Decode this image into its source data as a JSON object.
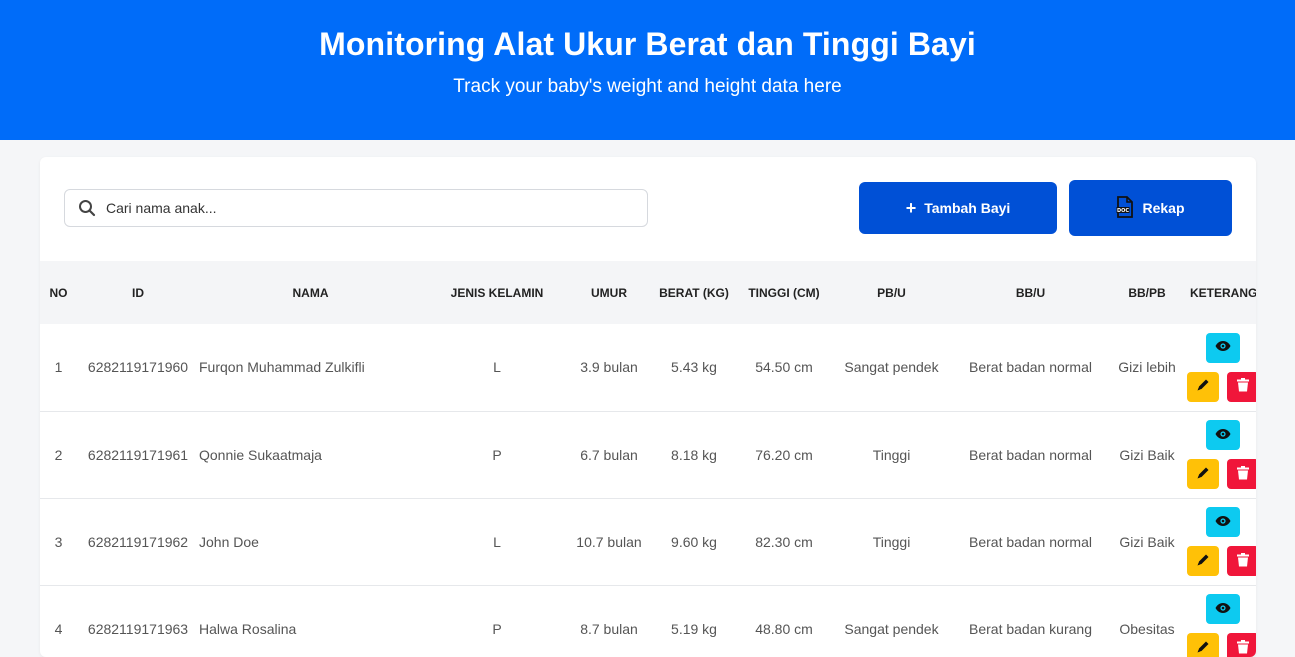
{
  "header": {
    "title": "Monitoring Alat Ukur Berat dan Tinggi Bayi",
    "subtitle": "Track your baby's weight and height data here"
  },
  "toolbar": {
    "search_placeholder": "Cari nama anak...",
    "search_icon": "search-icon",
    "add_label": "Tambah Bayi",
    "add_icon": "plus-icon",
    "rekap_label": "Rekap",
    "rekap_icon": "doc-file-icon"
  },
  "table": {
    "columns": [
      "NO",
      "ID",
      "NAMA",
      "JENIS KELAMIN",
      "UMUR",
      "BERAT (KG)",
      "TINGGI (CM)",
      "PB/U",
      "BB/U",
      "BB/PB",
      "KETERANGAN"
    ],
    "rows": [
      {
        "no": "1",
        "id": "6282119171960",
        "nama": "Furqon Muhammad Zulkifli",
        "jk": "L",
        "umur": "3.9 bulan",
        "berat": "5.43 kg",
        "tinggi": "54.50 cm",
        "pbu": "Sangat pendek",
        "bbu": "Berat badan normal",
        "bbpb": "Gizi lebih"
      },
      {
        "no": "2",
        "id": "6282119171961",
        "nama": "Qonnie Sukaatmaja",
        "jk": "P",
        "umur": "6.7 bulan",
        "berat": "8.18 kg",
        "tinggi": "76.20 cm",
        "pbu": "Tinggi",
        "bbu": "Berat badan normal",
        "bbpb": "Gizi Baik"
      },
      {
        "no": "3",
        "id": "6282119171962",
        "nama": "John Doe",
        "jk": "L",
        "umur": "10.7 bulan",
        "berat": "9.60 kg",
        "tinggi": "82.30 cm",
        "pbu": "Tinggi",
        "bbu": "Berat badan normal",
        "bbpb": "Gizi Baik"
      },
      {
        "no": "4",
        "id": "6282119171963",
        "nama": "Halwa Rosalina",
        "jk": "P",
        "umur": "8.7 bulan",
        "berat": "5.19 kg",
        "tinggi": "48.80 cm",
        "pbu": "Sangat pendek",
        "bbu": "Berat badan kurang",
        "bbpb": "Obesitas"
      }
    ],
    "actions": {
      "view_icon": "eye-icon",
      "edit_icon": "pencil-icon",
      "delete_icon": "trash-icon"
    }
  },
  "colors": {
    "brand": "#006cf9",
    "button": "#0050d6",
    "view": "#0dcaf0",
    "edit": "#ffc107",
    "delete": "#f0163a"
  }
}
